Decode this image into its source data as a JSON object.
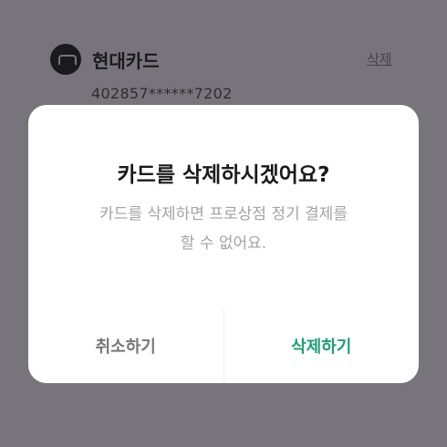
{
  "card": {
    "name": "현대카드",
    "number": "402857******7202",
    "delete_label": "삭제",
    "logo_icon": "hyundai-card-logo"
  },
  "dialog": {
    "title": "카드를 삭제하시겠어요?",
    "message": "카드를 삭제하면 프로상점 정기 결제를\n할 수 없어요.",
    "cancel_label": "취소하기",
    "confirm_label": "삭제하기"
  },
  "colors": {
    "overlay": "#77757b",
    "accent": "#1f9e73"
  }
}
